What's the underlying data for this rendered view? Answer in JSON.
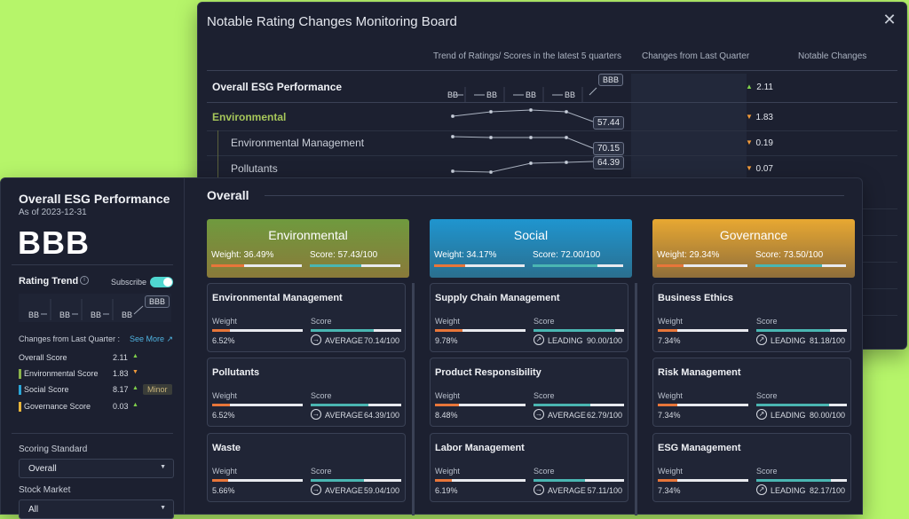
{
  "monitor": {
    "title": "Notable Rating Changes Monitoring Board",
    "columns": [
      "Trend of Ratings/ Scores in the latest 5 quarters",
      "Changes from Last Quarter",
      "Notable Changes"
    ],
    "rows": [
      {
        "label": "Overall ESG Performance",
        "change": "2.11",
        "direction": "up",
        "trend": [
          "BB",
          "BB",
          "BB",
          "BB",
          "BBB"
        ]
      },
      {
        "label": "Environmental",
        "change": "1.83",
        "direction": "down",
        "value": "57.44"
      },
      {
        "label": "Environmental Management",
        "change": "0.19",
        "direction": "down",
        "value": "70.15"
      },
      {
        "label": "Pollutants",
        "change": "0.07",
        "direction": "down",
        "value": "64.39"
      }
    ]
  },
  "sidebar": {
    "title": "Overall ESG Performance",
    "as_of": "As of 2023-12-31",
    "rating": "BBB",
    "rating_trend_label": "Rating Trend",
    "subscribe_label": "Subscribe",
    "trend": [
      "BB",
      "BB",
      "BB",
      "BB",
      "BBB"
    ],
    "changes_label": "Changes from Last Quarter :",
    "see_more": "See More ↗",
    "scores": [
      {
        "name": "Overall Score",
        "value": "2.11",
        "direction": "up",
        "color": ""
      },
      {
        "name": "Environmental Score",
        "value": "1.83",
        "direction": "down",
        "color": "#8ab34a"
      },
      {
        "name": "Social Score",
        "value": "8.17",
        "direction": "up",
        "color": "#2aa6d8",
        "tag": "Minor"
      },
      {
        "name": "Governance Score",
        "value": "0.03",
        "direction": "up",
        "color": "#e8b53a"
      }
    ],
    "scoring_standard_label": "Scoring Standard",
    "scoring_standard_value": "Overall",
    "stock_market_label": "Stock Market",
    "stock_market_value": "All"
  },
  "main": {
    "title": "Overall",
    "pillars": [
      {
        "name": "Environmental",
        "weight": "Weight: 36.49%",
        "score": "Score: 57.43/100",
        "weight_frac": 0.36,
        "score_frac": 0.57,
        "color": "#6f9a3e",
        "items": [
          {
            "name": "Environmental Management",
            "weight": "6.52%",
            "level": "AVERAGE",
            "score": "70.14/100",
            "w": 0.2,
            "s": 0.7
          },
          {
            "name": "Pollutants",
            "weight": "6.52%",
            "level": "AVERAGE",
            "score": "64.39/100",
            "w": 0.2,
            "s": 0.64
          },
          {
            "name": "Waste",
            "weight": "5.66%",
            "level": "AVERAGE",
            "score": "59.04/100",
            "w": 0.18,
            "s": 0.59
          }
        ]
      },
      {
        "name": "Social",
        "weight": "Weight: 34.17%",
        "score": "Score: 72.00/100",
        "weight_frac": 0.34,
        "score_frac": 0.72,
        "color": "#1f8fc6",
        "items": [
          {
            "name": "Supply Chain Management",
            "weight": "9.78%",
            "level": "LEADING",
            "score": "90.00/100",
            "w": 0.3,
            "s": 0.9
          },
          {
            "name": "Product Responsibility",
            "weight": "8.48%",
            "level": "AVERAGE",
            "score": "62.79/100",
            "w": 0.26,
            "s": 0.63
          },
          {
            "name": "Labor Management",
            "weight": "6.19%",
            "level": "AVERAGE",
            "score": "57.11/100",
            "w": 0.19,
            "s": 0.57
          }
        ]
      },
      {
        "name": "Governance",
        "weight": "Weight: 29.34%",
        "score": "Score: 73.50/100",
        "weight_frac": 0.29,
        "score_frac": 0.74,
        "color": "#e0a030",
        "items": [
          {
            "name": "Business Ethics",
            "weight": "7.34%",
            "level": "LEADING",
            "score": "81.18/100",
            "w": 0.22,
            "s": 0.81
          },
          {
            "name": "Risk Management",
            "weight": "7.34%",
            "level": "LEADING",
            "score": "80.00/100",
            "w": 0.22,
            "s": 0.8
          },
          {
            "name": "ESG Management",
            "weight": "7.34%",
            "level": "LEADING",
            "score": "82.17/100",
            "w": 0.22,
            "s": 0.82
          }
        ]
      }
    ],
    "card_labels": {
      "weight": "Weight",
      "score": "Score"
    }
  }
}
